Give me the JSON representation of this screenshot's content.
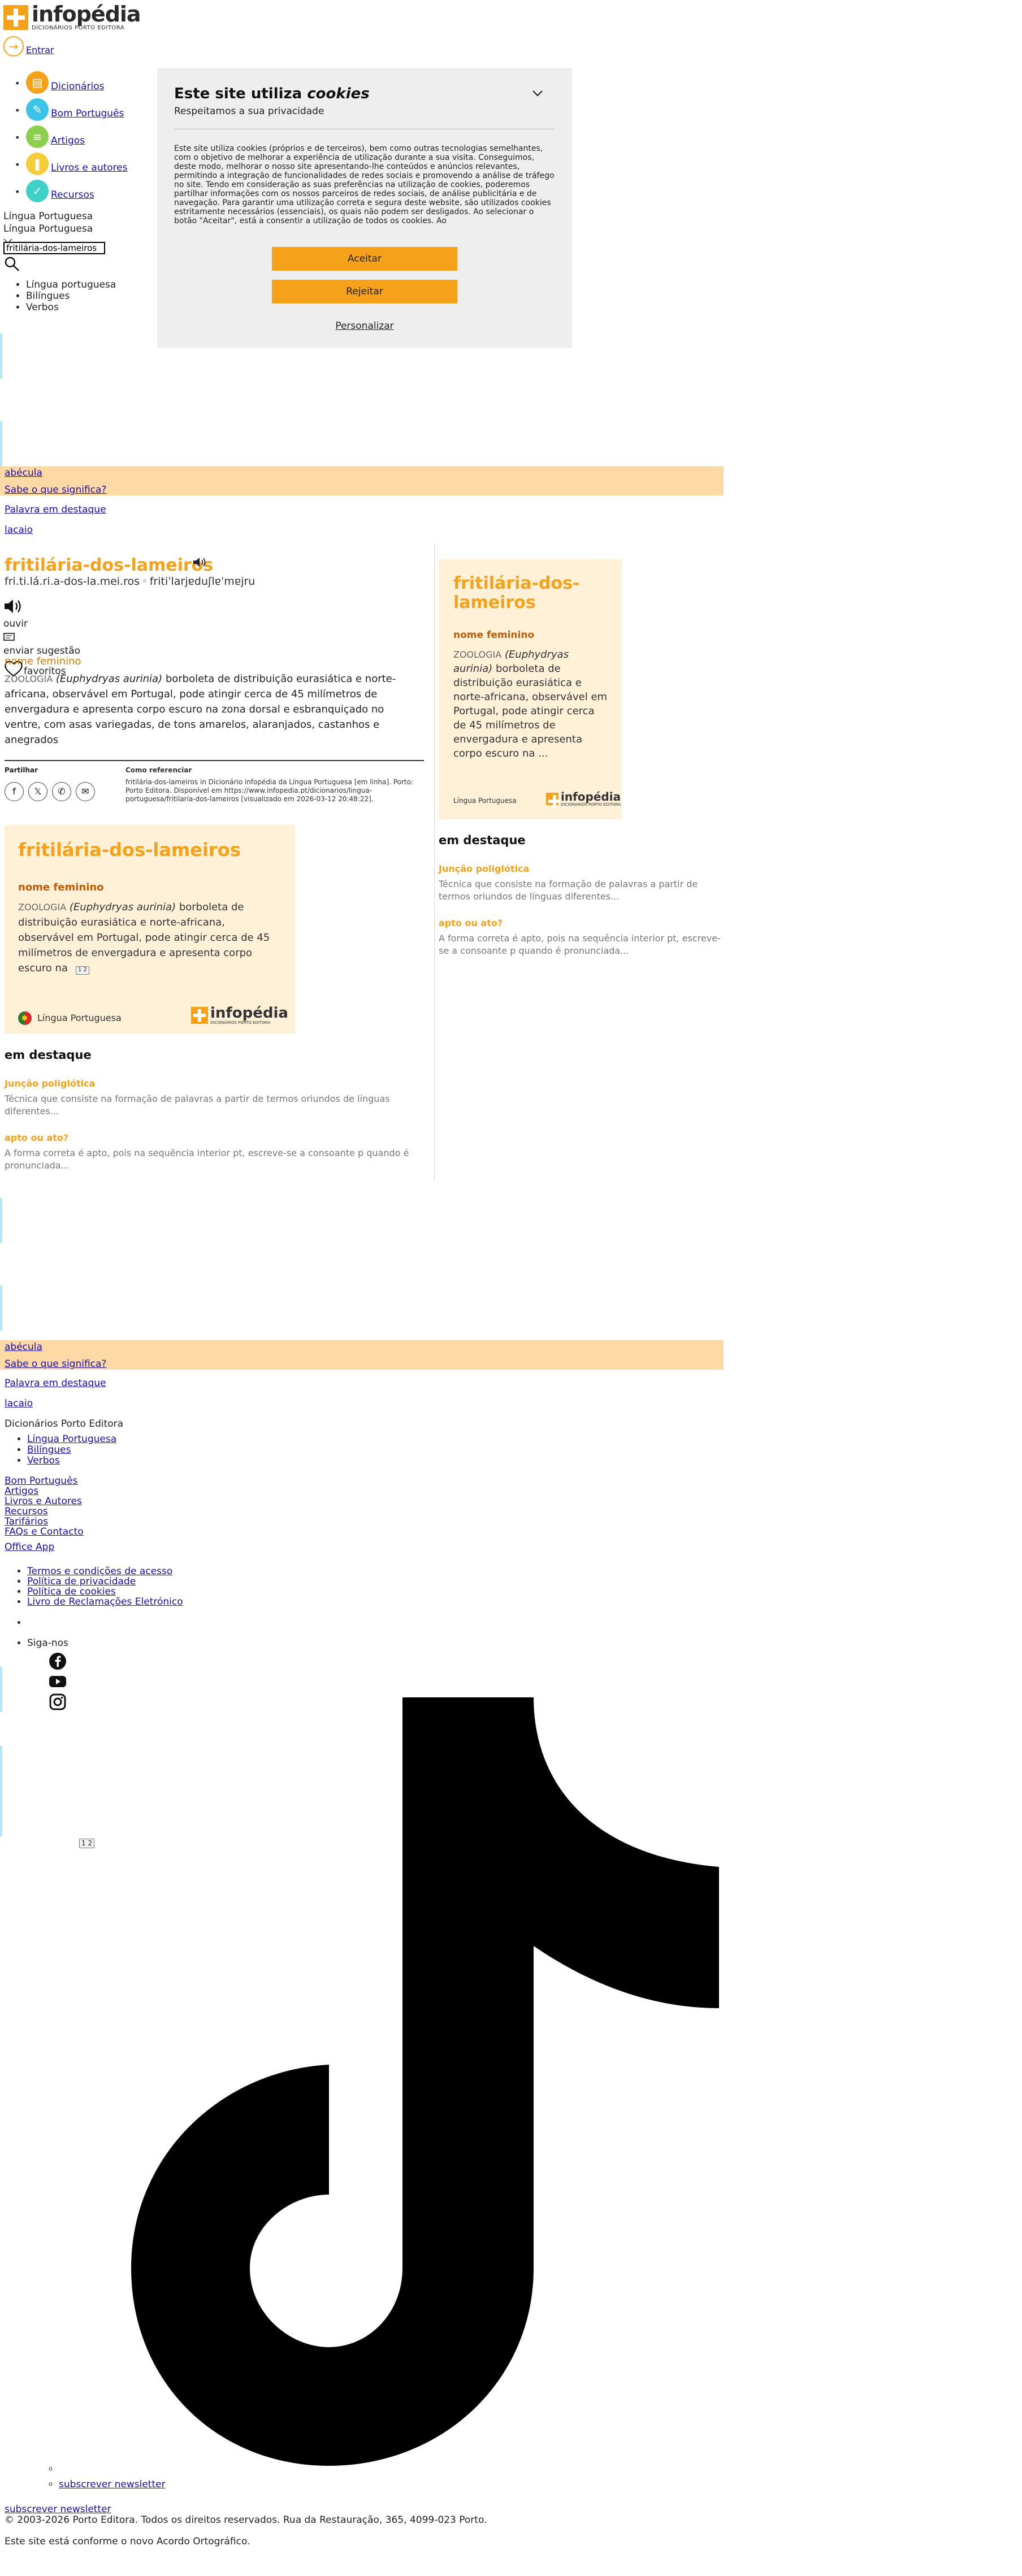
{
  "header": {
    "logo_word": "infopédia",
    "logo_sub": "DICIONÁRIOS PORTO EDITORA",
    "login_label": "Entrar"
  },
  "nav": {
    "items": [
      {
        "label": "Dicionários",
        "color": "#f5a21a",
        "icon": "book-icon"
      },
      {
        "label": "Bom Português",
        "color": "#3cc3e8",
        "icon": "chat-icon"
      },
      {
        "label": "Artigos",
        "color": "#8ccf4d",
        "icon": "article-icon"
      },
      {
        "label": "Livros e autores",
        "color": "#f5cd3a",
        "icon": "books-icon"
      },
      {
        "label": "Recursos",
        "color": "#3fd1c6",
        "icon": "resources-icon"
      }
    ]
  },
  "search": {
    "selected_lang": "Língua Portuguesa",
    "selected_lang_repeat": "Língua Portuguesa",
    "value": "fritilária-dos-lameiros",
    "options": [
      "Língua portuguesa",
      "Bilíngues",
      "Verbos"
    ]
  },
  "cookie": {
    "title_pre": "Este site utiliza ",
    "title_em": "cookies",
    "subtitle": "Respeitamos a sua privacidade",
    "body": "Este site utiliza cookies (próprios e de terceiros), bem como outras tecnologias semelhantes, com o objetivo de melhorar a experiência de utilização durante a sua visita. Conseguimos, deste modo, melhorar o nosso site apresentando-lhe conteúdos e anúncios relevantes, permitindo a integração de funcionalidades de redes sociais e promovendo a análise de tráfego no site. Tendo em consideração as suas preferências na utilização de cookies, poderemos partilhar informações com os nossos parceiros de redes sociais, de análise publicitária e de navegação. Para garantir uma utilização correta e segura deste website, são utilizados cookies estritamente necessários (essenciais), os quais não podem ser desligados. Ao selecionar o botão \"Aceitar\", está a consentir a utilização de todos os cookies. Ao",
    "accept": "Aceitar",
    "reject": "Rejeitar",
    "personalize": "Personalizar"
  },
  "bar1": {
    "word": "abécula",
    "question": "Sabe o que significa?",
    "featured": "Palavra em destaque",
    "extra": "lacaio"
  },
  "entry": {
    "title": "fritilária-dos-lameiros",
    "syllables": "fri.ti.lá.ri.a-dos-la.mei.ros",
    "phonetic_sep": "⁰",
    "ipa": "fritiˈlarjɐduʃlɐˈmɐjru",
    "listen": "ouvir",
    "suggest": "enviar sugestão",
    "favorites": "favoritos",
    "gram": "nome feminino",
    "domain": "zoologia",
    "species": "(Euphydryas aurinia)",
    "definition": " borboleta de distribuição eurasiática e norte-africana, observável em Portugal, pode atingir cerca de 45 milímetros de envergadura e apresenta corpo escuro na zona dorsal e esbranquiçado no ventre, com asas variegadas, de tons amarelos, alaranjados, castanhos e anegrados"
  },
  "share": {
    "label": "Partilhar",
    "cite_title": "Como referenciar",
    "cite_text": "fritilária-dos-lameiros in Dicionário infopédia da Língua Portuguesa [em linha]. Porto: Porto Editora. Disponível em https://www.infopedia.pt/dicionarios/lingua-portuguesa/fritilaria-dos-lameiros [visualizado em 2026-03-12 20:48:22]."
  },
  "card": {
    "title": "fritilária-dos-lameiros",
    "gram": "nome feminino",
    "domain": "zoologia",
    "species": "(Euphydryas aurinia)",
    "def_short": " borboleta de distribuição eurasiática e norte-africana, observável em Portugal, pode atingir cerca de 45 milímetros de envergadura e apresenta corpo escuro na ...",
    "def_left": " borboleta de distribuição eurasiática e norte-africana, observável em Portugal, pode atingir cerca de 45 milímetros de envergadura e apresenta corpo escuro na",
    "language": "Língua Portuguesa",
    "logo": "infopédia",
    "logo_sub": "DICIONÁRIOS PORTO EDITORA",
    "pager": "1 2"
  },
  "destaque": {
    "heading": "em destaque",
    "items": [
      {
        "title": "Junção poliglótica",
        "desc": "Técnica que consiste na formação de palavras a partir de termos oriundos de línguas diferentes..."
      },
      {
        "title": "apto ou ato?",
        "desc": "A forma correta é apto, pois na sequência interior pt, escreve-se a consoante p quando é pronunciada..."
      }
    ]
  },
  "bar2": {
    "word": "abécula",
    "question": "Sabe o que significa?",
    "featured": "Palavra em destaque",
    "extra": "lacaio"
  },
  "footer": {
    "dict_title": "Dicionários Porto Editora",
    "dict_items": [
      "Língua Portuguesa",
      "Bilíngues",
      "Verbos"
    ],
    "links": [
      "Bom Português",
      "Artigos",
      "Livros e Autores",
      "Recursos",
      "Tarifários",
      "FAQs e Contacto"
    ],
    "office": "Office App",
    "legal": [
      "Termos e condições de acesso",
      "Política de privacidade",
      "Política de cookies",
      "Livro de Reclamações Eletrónico"
    ],
    "follow": "Siga-nos",
    "pager": "1 2",
    "newsletter": "subscrever newsletter",
    "newsletter_repeat": "subscrever newsletter",
    "copyright": "© 2003-2026 Porto Editora. Todos os direitos reservados. Rua da Restauração, 365, 4099-023 Porto.",
    "acordo": "Este site está conforme o novo Acordo Ortográfico."
  }
}
